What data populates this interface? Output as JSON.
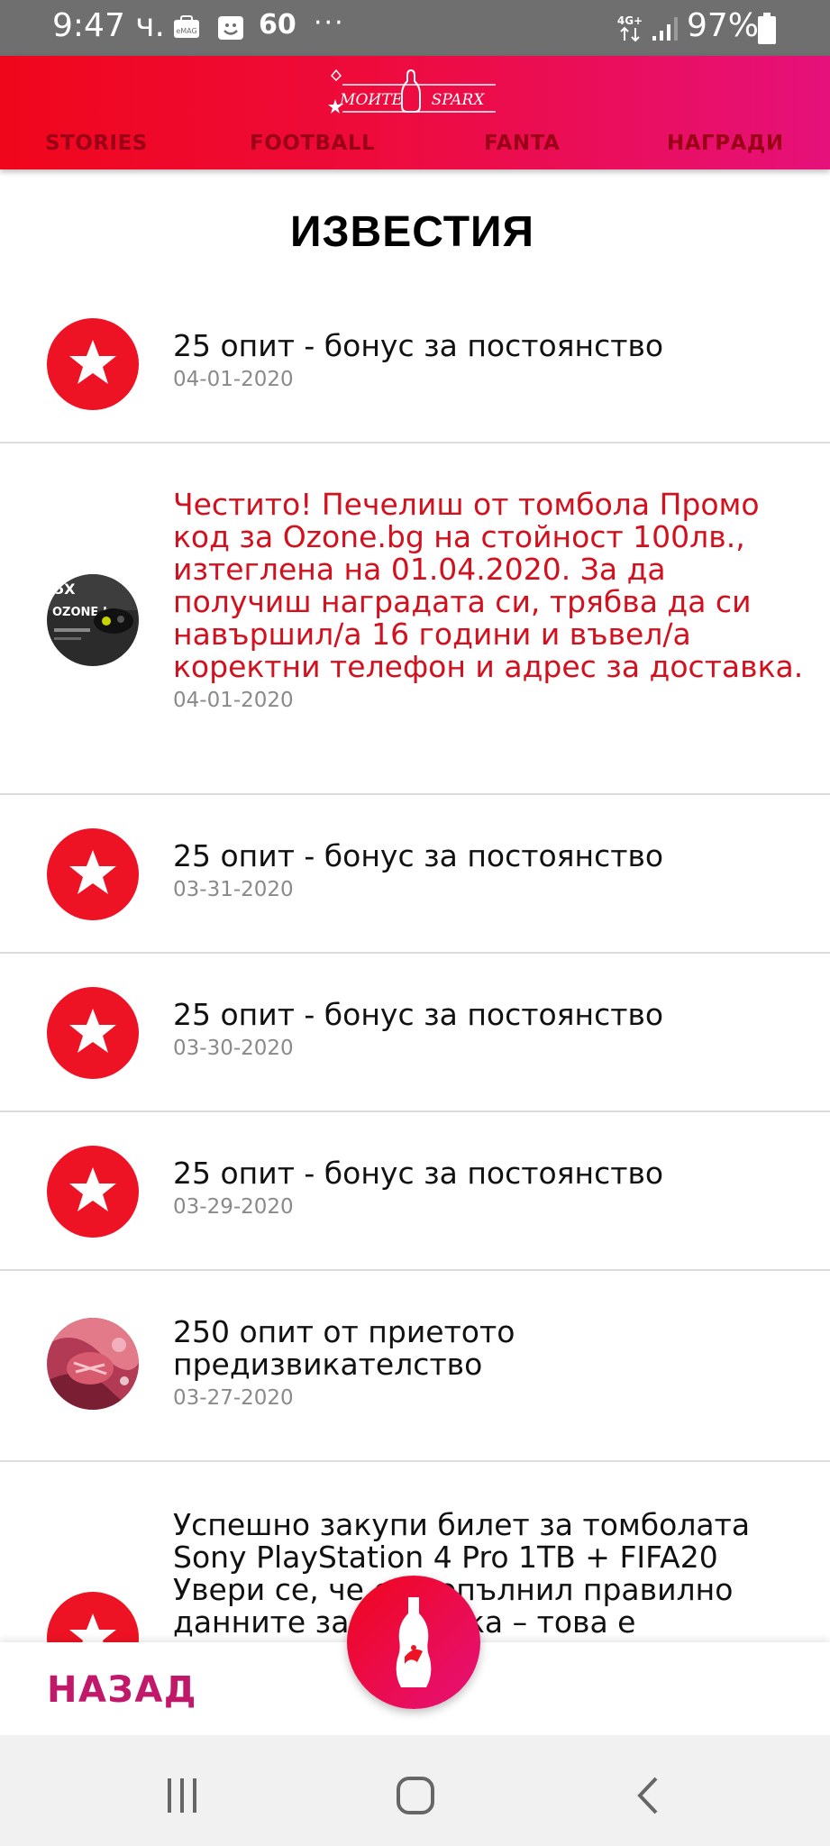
{
  "status_bar": {
    "time": "9:47 ч.",
    "notification_count": "60",
    "more": "···",
    "network": "4G+",
    "battery": "97%"
  },
  "header": {
    "logo_text": "MOИTE SPARX",
    "tabs": [
      {
        "label": "STORIES"
      },
      {
        "label": "FOOTBALL"
      },
      {
        "label": "FANTA"
      },
      {
        "label": "НАГРАДИ"
      }
    ]
  },
  "page": {
    "title": "ИЗВЕСТИЯ"
  },
  "news": [
    {
      "title": "25 опит - бонус за постоянство",
      "date": "04-01-2020",
      "icon": "star-icon"
    },
    {
      "title": "Честито! Печелиш от томбола Промо код за Ozone.bg на стойност 100лв., изтеглена на 01.04.2020. За да получиш наградата си, трябва да си навършил/а 16 години и въвел/а коректни телефон и адрес за доставка.",
      "date": "04-01-2020",
      "icon": "ozone-thumbnail",
      "thumb_text": "OZONE.bg"
    },
    {
      "title": "25 опит - бонус за постоянство",
      "date": "03-31-2020",
      "icon": "star-icon"
    },
    {
      "title": "25 опит - бонус за постоянство",
      "date": "03-30-2020",
      "icon": "star-icon"
    },
    {
      "title": "25 опит - бонус за постоянство",
      "date": "03-29-2020",
      "icon": "star-icon"
    },
    {
      "title": "250 опит от приетото предизвикателство",
      "date": "03-27-2020",
      "icon": "challenge-thumbnail"
    },
    {
      "title": "Успешно закупи билет за томболата Sony PlayStation 4 Pro 1TB + FIFA20 Увери се, че си попълнил правилно данните за доставка – това е",
      "date": "",
      "icon": "star-icon"
    }
  ],
  "bottom_bar": {
    "back_label": "НАЗАД"
  },
  "colors": {
    "brand_red": "#f0061b",
    "brand_pink": "#e6117a",
    "highlight_text": "#d3101d",
    "back_label": "#c2186a"
  }
}
